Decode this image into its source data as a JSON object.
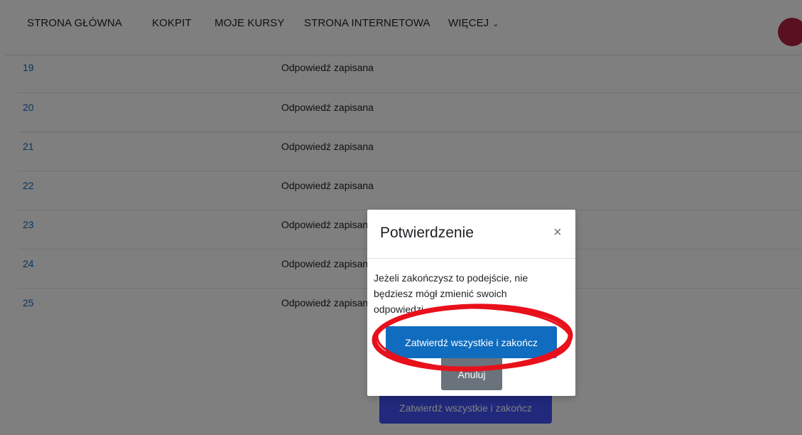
{
  "nav": {
    "items": [
      {
        "label": "STRONA GŁÓWNA"
      },
      {
        "label": "KOKPIT"
      },
      {
        "label": "MOJE KURSY"
      },
      {
        "label": "STRONA INTERNETOWA"
      },
      {
        "label": "WIĘCEJ"
      }
    ],
    "more_icon": "chevron-down-icon",
    "avatar_color": "#b4213d"
  },
  "summary": {
    "rows": [
      {
        "question": "19",
        "status": "Odpowiedź zapisana"
      },
      {
        "question": "20",
        "status": "Odpowiedź zapisana"
      },
      {
        "question": "21",
        "status": "Odpowiedź zapisana"
      },
      {
        "question": "22",
        "status": "Odpowiedź zapisana"
      },
      {
        "question": "23",
        "status": "Odpowiedź zapisana"
      },
      {
        "question": "24",
        "status": "Odpowiedź zapisana"
      },
      {
        "question": "25",
        "status": "Odpowiedź zapisana"
      }
    ],
    "submit_label": "Zatwierdź wszystkie i zakończ"
  },
  "modal": {
    "title": "Potwierdzenie",
    "close_icon": "close-icon",
    "message": "Jeżeli zakończysz to podejście, nie będziesz mógł zmienić swoich odpowiedzi.",
    "confirm_label": "Zatwierdź wszystkie i zakończ",
    "cancel_label": "Anuluj"
  },
  "colors": {
    "link": "#0f6cbf",
    "primary": "#0f6cbf",
    "secondary": "#6a737b",
    "highlight": "#e8101a",
    "submit_bg": "#4152f6"
  }
}
